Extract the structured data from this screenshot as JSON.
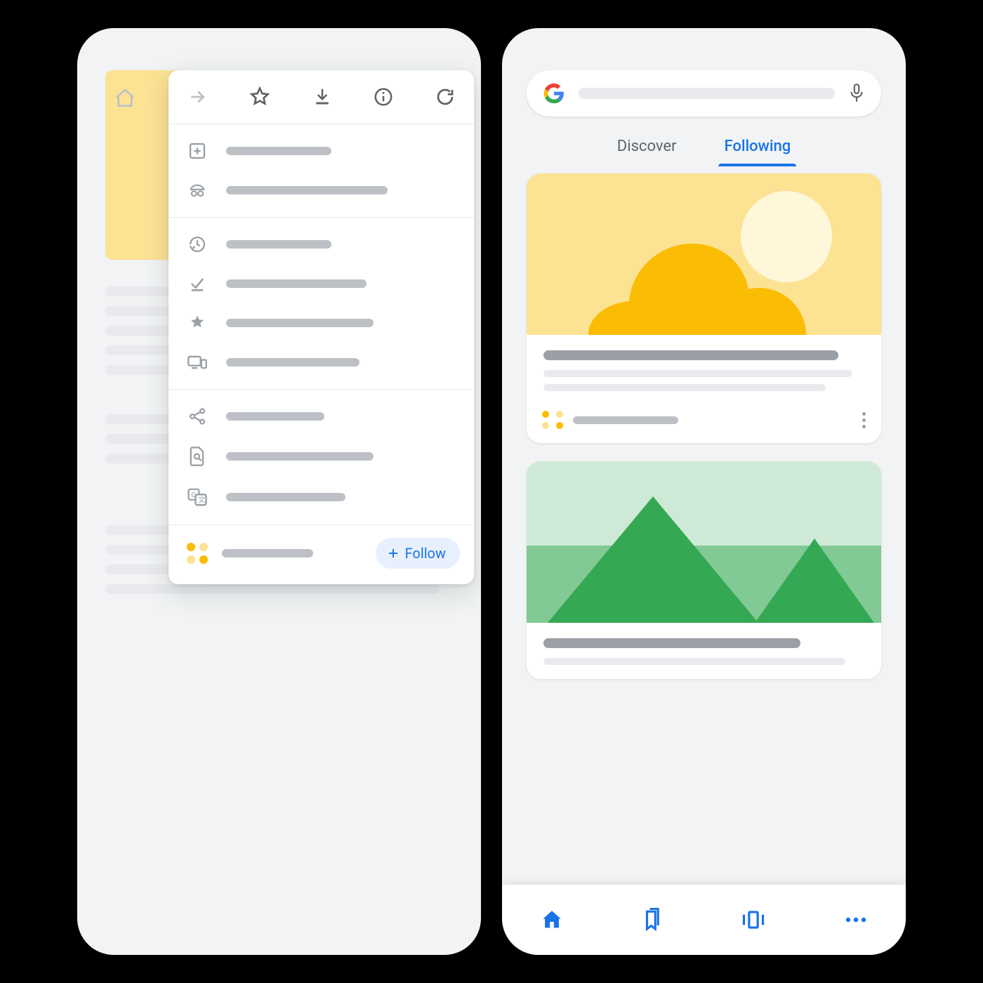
{
  "left_phone": {
    "home_icon": "home-icon",
    "toolbar": {
      "forward_icon": "forward-arrow-icon",
      "star_icon": "star-outline-icon",
      "download_icon": "download-icon",
      "info_icon": "info-circle-icon",
      "reload_icon": "reload-icon"
    },
    "menu": {
      "group1": [
        {
          "icon": "new-tab-plus-icon"
        },
        {
          "icon": "incognito-icon"
        }
      ],
      "group2": [
        {
          "icon": "history-clock-icon"
        },
        {
          "icon": "downloads-check-icon"
        },
        {
          "icon": "bookmarks-star-icon"
        },
        {
          "icon": "recent-tabs-devices-icon"
        }
      ],
      "group3": [
        {
          "icon": "share-icon"
        },
        {
          "icon": "find-in-page-icon"
        },
        {
          "icon": "translate-icon"
        }
      ],
      "follow": {
        "site_icon": "site-colored-dots-icon",
        "chip_icon": "plus-icon",
        "chip_label": "Follow"
      }
    }
  },
  "right_phone": {
    "search": {
      "logo": "google-g-logo",
      "mic_icon": "microphone-icon",
      "placeholder": ""
    },
    "tabs": {
      "discover_label": "Discover",
      "following_label": "Following",
      "active": "following"
    },
    "cards": [
      {
        "kind": "sun-cloud",
        "source_icon": "site-colored-dots-icon"
      },
      {
        "kind": "hills",
        "source_icon": "site-colored-dots-icon"
      }
    ],
    "bottom_nav": {
      "home_icon": "home-filled-icon",
      "bookmarks_icon": "bookmarks-outline-icon",
      "tabswitcher_icon": "tab-carousel-icon",
      "more_icon": "more-horizontal-icon"
    }
  },
  "colors": {
    "blue": "#1a73e8",
    "yellow": "#fbbc04",
    "green": "#34a853"
  }
}
